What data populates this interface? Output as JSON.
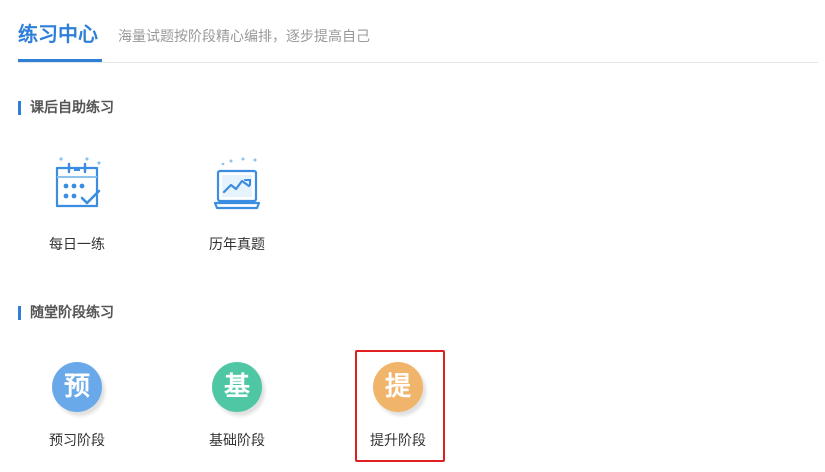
{
  "header": {
    "title": "练习中心",
    "subtitle": "海量试题按阶段精心编排，逐步提高自己",
    "accent_color": "#2f7fd8"
  },
  "sections": [
    {
      "title": "课后自助练习",
      "items": [
        {
          "label": "每日一练",
          "icon": "calendar-check-icon"
        },
        {
          "label": "历年真题",
          "icon": "laptop-chart-icon"
        }
      ]
    },
    {
      "title": "随堂阶段练习",
      "items": [
        {
          "label": "预习阶段",
          "glyph": "预",
          "color": "#6aa9e9",
          "icon": "preview-badge-icon"
        },
        {
          "label": "基础阶段",
          "glyph": "基",
          "color": "#4fc7a4",
          "icon": "basic-badge-icon"
        },
        {
          "label": "提升阶段",
          "glyph": "提",
          "color": "#f0b46a",
          "icon": "advance-badge-icon",
          "highlighted": true
        }
      ]
    }
  ]
}
